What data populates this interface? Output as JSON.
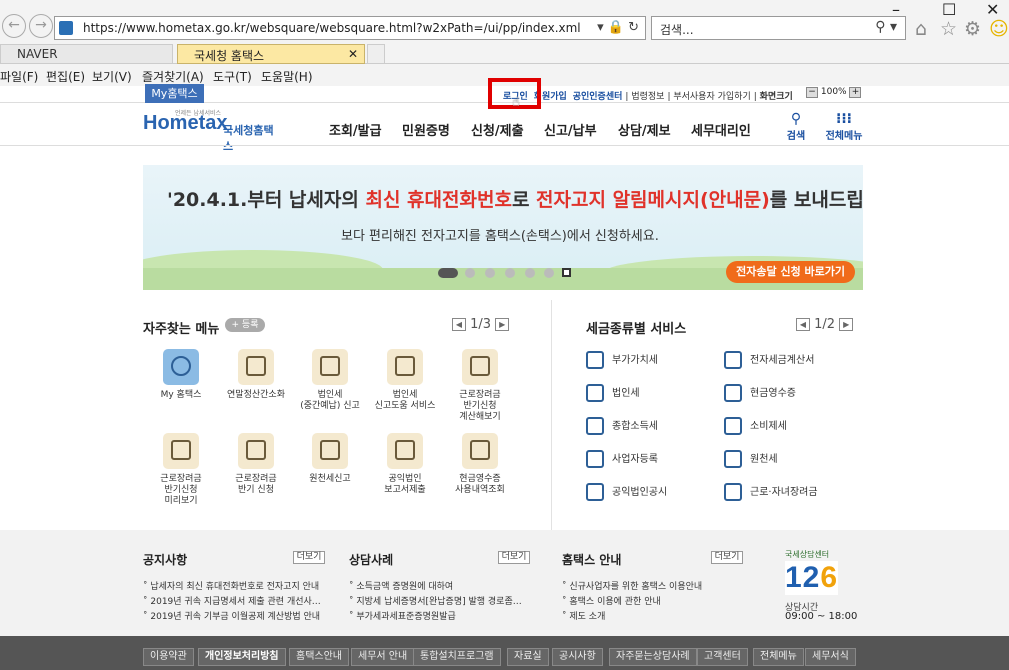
{
  "browser": {
    "url": "https://www.hometax.go.kr/websquare/websquare.html?w2xPath=/ui/pp/index.xml",
    "search_placeholder": "검색...",
    "tabs": [
      {
        "label": "NAVER"
      },
      {
        "label": "국세청 홈택스"
      }
    ],
    "menu": [
      "파일(F)",
      "편집(E)",
      "보기(V)",
      "즐겨찾기(A)",
      "도구(T)",
      "도움말(H)"
    ]
  },
  "header": {
    "my_hometax": "My홈택스",
    "util_links": [
      "로그인",
      "회원가입",
      "공인인증센터",
      "법령정보",
      "부서사용자 가입하기",
      "화면크기"
    ],
    "zoom": "100%",
    "logo_small": "언제든 납세서비스",
    "logo_main": "Hometax",
    "logo_sub": "국세청홈택스",
    "gnb": [
      "조회/발급",
      "민원증명",
      "신청/제출",
      "신고/납부",
      "상담/제보",
      "세무대리인"
    ],
    "search_label": "검색",
    "all_menu_label": "전체메뉴"
  },
  "banner": {
    "line1_pre": "'20.4.1.부터 납세자의 ",
    "line1_hl1": "최신 휴대전화번호",
    "line1_mid": "로 ",
    "line1_hl2": "전자고지 알림메시지(안내문)",
    "line1_post": "를 보내드립니다!",
    "line2": "보다 편리해진 전자고지를 홈택스(손택스)에서 신청하세요.",
    "button": "전자송달 신청 바로가기"
  },
  "quick": {
    "title": "자주찾는 메뉴",
    "register": "등록",
    "page": "1/3",
    "items": [
      {
        "label": "My 홈택스"
      },
      {
        "label": "연말정산간소화"
      },
      {
        "label": "법인세\n(중간예납) 신고"
      },
      {
        "label": "법인세\n신고도움 서비스"
      },
      {
        "label": "근로장려금\n반기신청\n계산해보기"
      },
      {
        "label": "근로장려금\n반기신청\n미리보기"
      },
      {
        "label": "근로장려금\n반기 신청"
      },
      {
        "label": "원천세신고"
      },
      {
        "label": "공익법인\n보고서제출"
      },
      {
        "label": "현금영수증\n사용내역조회"
      }
    ]
  },
  "taxservice": {
    "title": "세금종류별 서비스",
    "page": "1/2",
    "items": [
      "부가가치세",
      "전자세금계산서",
      "법인세",
      "현금영수증",
      "종합소득세",
      "소비제세",
      "사업자등록",
      "원천세",
      "공익법인공시",
      "근로·자녀장려금"
    ]
  },
  "notices": {
    "more": "더보기",
    "cols": [
      {
        "title": "공지사항",
        "items": [
          "납세자의 최신 휴대전화번호로 전자고지 안내",
          "2019년 귀속 지급명세서 제출 관련 개선사…",
          "2019년 귀속 기부금 이월공제 계산방법 안내"
        ]
      },
      {
        "title": "상담사례",
        "items": [
          "소득금액 증명원에 대하여",
          "지방세 납세증명서[완납증명] 발행 경로좀…",
          "부가세과세표준증명원발급"
        ]
      },
      {
        "title": "홈택스 안내",
        "items": [
          "신규사업자를 위한 홈택스 이용안내",
          "홈택스 이용에 관한 안내",
          "제도 소개"
        ]
      }
    ]
  },
  "callcenter": {
    "caption": "국세상담센터",
    "number_pre": "12",
    "number_hl": "6",
    "hours_label": "상담시간",
    "hours": "09:00 ~ 18:00"
  },
  "footer": [
    "이용약관",
    "개인정보처리방침",
    "홈택스안내",
    "세무서 안내",
    "통합설치프로그램",
    "자료실",
    "공시사항",
    "자주묻는상담사례",
    "고객센터",
    "전체메뉴",
    "세무서식"
  ]
}
